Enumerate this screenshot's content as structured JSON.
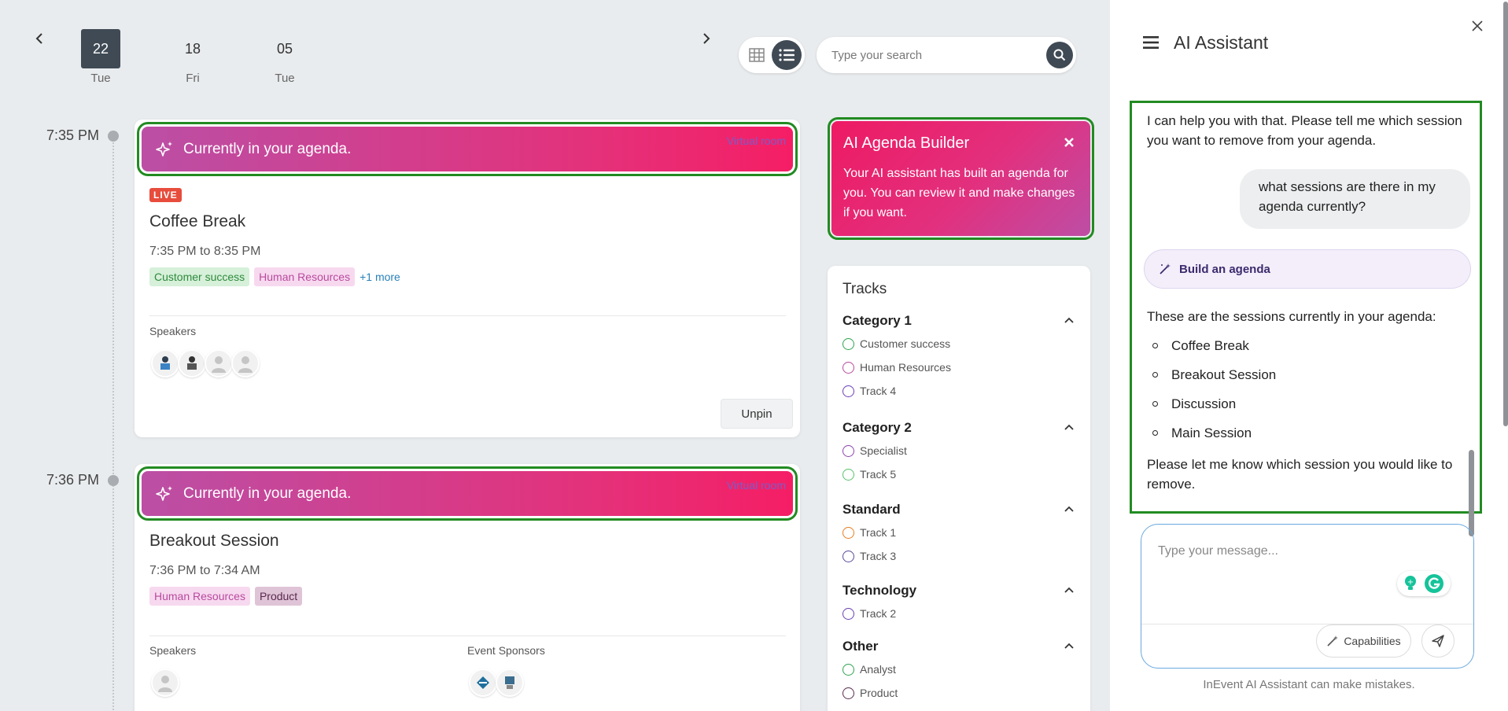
{
  "dates": [
    {
      "num": "22",
      "day": "Tue"
    },
    {
      "num": "18",
      "day": "Fri"
    },
    {
      "num": "05",
      "day": "Tue"
    }
  ],
  "search": {
    "placeholder": "Type your search"
  },
  "sessions": [
    {
      "time": "7:35 PM",
      "banner": "Currently in your agenda.",
      "room_link": "Virtual room",
      "live": "LIVE",
      "title": "Coffee Break",
      "time_range": "7:35 PM to 8:35 PM",
      "tags": [
        "Customer success",
        "Human Resources"
      ],
      "more": "+1 more",
      "speakers_label": "Speakers",
      "unpin_label": "Unpin"
    },
    {
      "time": "7:36 PM",
      "banner": "Currently in your agenda.",
      "room_link": "Virtual room",
      "title": "Breakout Session",
      "time_range": "7:36 PM to 7:34 AM",
      "tags": [
        "Human Resources",
        "Product"
      ],
      "speakers_label": "Speakers",
      "sponsors_label": "Event Sponsors"
    }
  ],
  "builder": {
    "title": "AI Agenda Builder",
    "text": "Your AI assistant has built an agenda for you. You can review it and make changes if you want."
  },
  "tracks": {
    "title": "Tracks",
    "categories": [
      {
        "name": "Category 1",
        "items": [
          {
            "label": "Customer success",
            "color": "#2ea44f"
          },
          {
            "label": "Human Resources",
            "color": "#b84a9e"
          },
          {
            "label": "Track 4",
            "color": "#6c3fb5"
          }
        ]
      },
      {
        "name": "Category 2",
        "items": [
          {
            "label": "Specialist",
            "color": "#8e44ad"
          },
          {
            "label": "Track 5",
            "color": "#58c26a"
          }
        ]
      },
      {
        "name": "Standard",
        "items": [
          {
            "label": "Track 1",
            "color": "#e67e22"
          },
          {
            "label": "Track 3",
            "color": "#5b4a9e"
          }
        ]
      },
      {
        "name": "Technology",
        "items": [
          {
            "label": "Track 2",
            "color": "#6a3fb0"
          }
        ]
      },
      {
        "name": "Other",
        "items": [
          {
            "label": "Analyst",
            "color": "#2ea44f"
          },
          {
            "label": "Product",
            "color": "#5a2a4e"
          }
        ]
      }
    ]
  },
  "assistant": {
    "title": "AI Assistant",
    "messages": {
      "bot_1": "I can help you with that. Please tell me which session you want to remove from your agenda.",
      "user_1": "what sessions are there in my agenda currently?",
      "build_pill": "Build an agenda",
      "bot_2_intro": "These are the sessions currently in your agenda:",
      "bot_2_list": [
        "Coffee Break",
        "Breakout Session",
        "Discussion",
        "Main Session"
      ],
      "bot_2_outro": "Please let me know which session you would like to remove."
    },
    "composer_placeholder": "Type your message...",
    "capabilities_label": "Capabilities",
    "disclaimer": "InEvent AI Assistant can make mistakes."
  },
  "colors": {
    "accent_dark": "#3f4a55",
    "banner_gradient_start": "#bb4fa5",
    "banner_gradient_end": "#f51e65",
    "highlight_outline": "#228b22"
  }
}
